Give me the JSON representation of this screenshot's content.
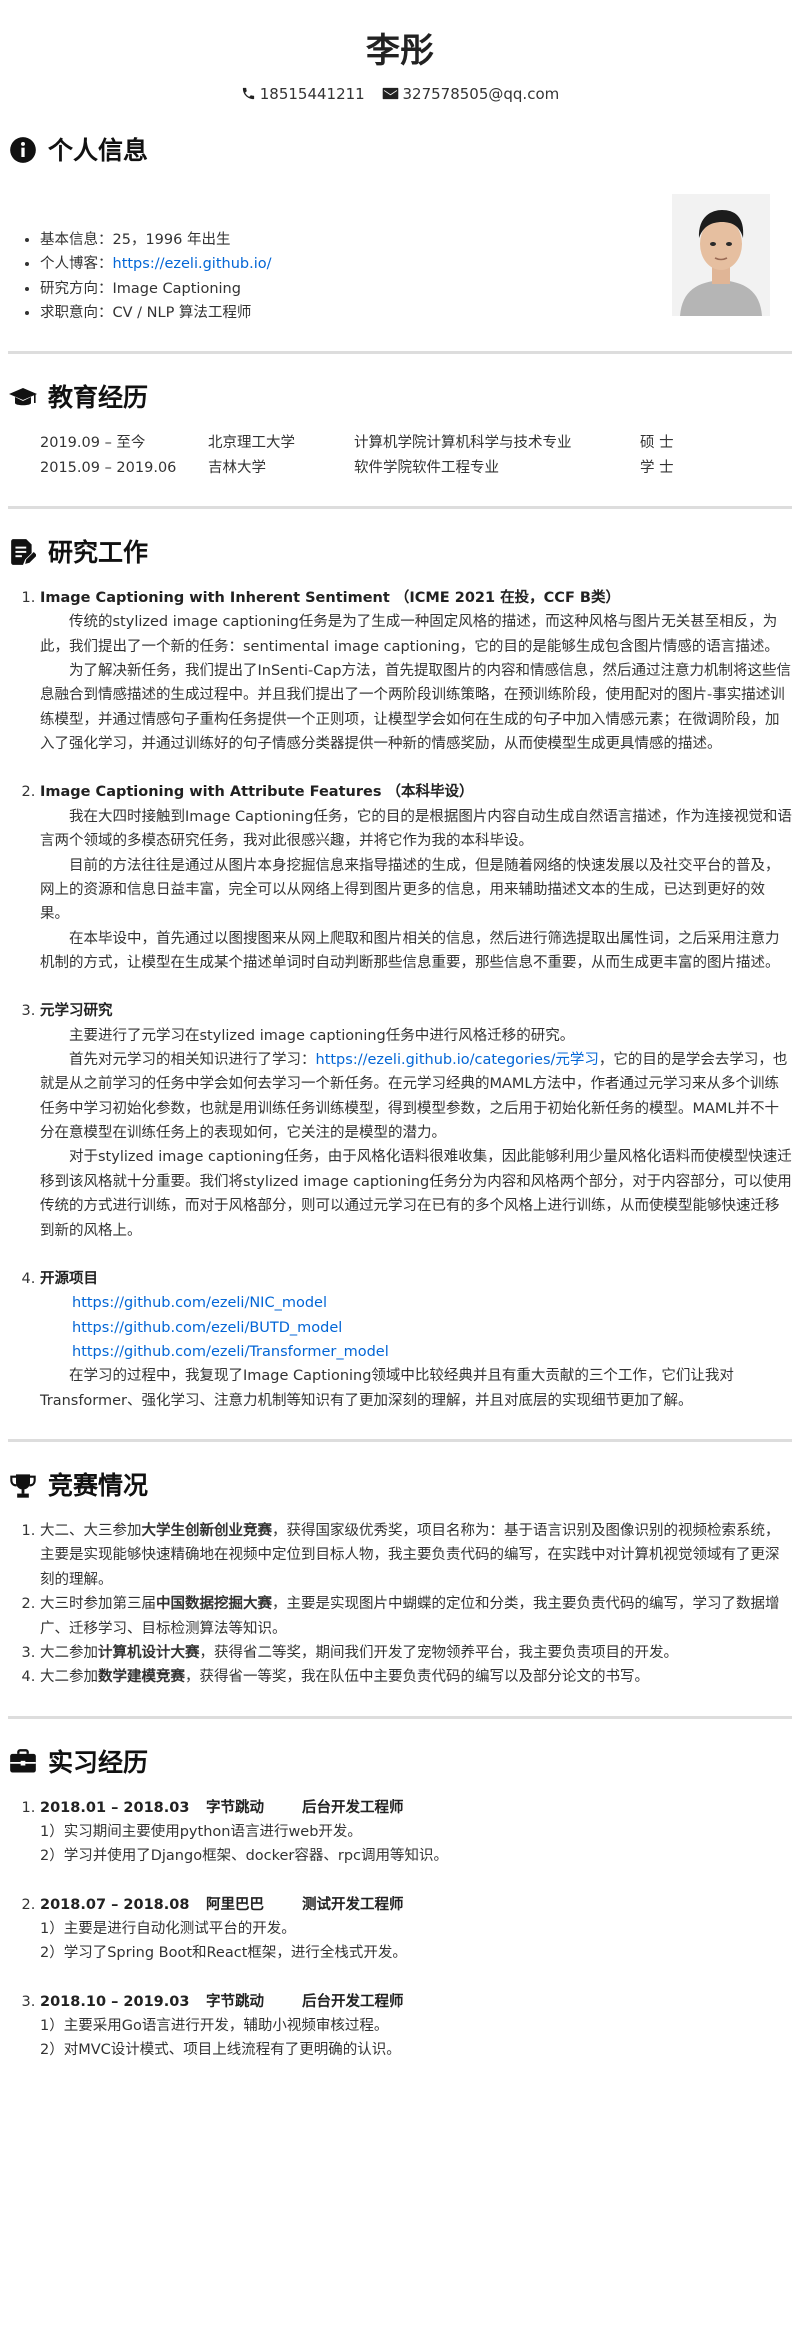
{
  "header": {
    "name": "李彤",
    "phone": "18515441211",
    "email": "327578505@qq.com"
  },
  "sections": {
    "personal": "个人信息",
    "education": "教育经历",
    "research": "研究工作",
    "competition": "竞赛情况",
    "internship": "实习经历"
  },
  "personal": {
    "items": [
      {
        "label": "基本信息：",
        "value": "25，1996 年出生"
      },
      {
        "label": "个人博客：",
        "link": "https://ezeli.github.io/"
      },
      {
        "label": "研究方向：",
        "value": "Image Captioning"
      },
      {
        "label": "求职意向：",
        "value": "CV / NLP 算法工程师"
      }
    ]
  },
  "education": [
    {
      "period": "2019.09 – 至今",
      "school": "北京理工大学",
      "major": "计算机学院计算机科学与技术专业",
      "degree": "硕 士"
    },
    {
      "period": "2015.09 – 2019.06",
      "school": "吉林大学",
      "major": "软件学院软件工程专业",
      "degree": "学 士"
    }
  ],
  "research": {
    "r1": {
      "title": "Image Captioning with Inherent Sentiment （ICME 2021 在投，CCF B类）",
      "p1": "传统的stylized image captioning任务是为了生成一种固定风格的描述，而这种风格与图片无关甚至相反，为此，我们提出了一个新的任务：sentimental image captioning，它的目的是能够生成包含图片情感的语言描述。",
      "p2": "为了解决新任务，我们提出了InSenti-Cap方法，首先提取图片的内容和情感信息，然后通过注意力机制将这些信息融合到情感描述的生成过程中。并且我们提出了一个两阶段训练策略，在预训练阶段，使用配对的图片-事实描述训练模型，并通过情感句子重构任务提供一个正则项，让模型学会如何在生成的句子中加入情感元素；在微调阶段，加入了强化学习，并通过训练好的句子情感分类器提供一种新的情感奖励，从而使模型生成更具情感的描述。"
    },
    "r2": {
      "title": "Image Captioning with Attribute Features （本科毕设）",
      "p1": "我在大四时接触到Image Captioning任务，它的目的是根据图片内容自动生成自然语言描述，作为连接视觉和语言两个领域的多模态研究任务，我对此很感兴趣，并将它作为我的本科毕设。",
      "p2": "目前的方法往往是通过从图片本身挖掘信息来指导描述的生成，但是随着网络的快速发展以及社交平台的普及，网上的资源和信息日益丰富，完全可以从网络上得到图片更多的信息，用来辅助描述文本的生成，已达到更好的效果。",
      "p3": "在本毕设中，首先通过以图搜图来从网上爬取和图片相关的信息，然后进行筛选提取出属性词，之后采用注意力机制的方式，让模型在生成某个描述单词时自动判断那些信息重要，那些信息不重要，从而生成更丰富的图片描述。"
    },
    "r3": {
      "title": "元学习研究",
      "p0": "主要进行了元学习在stylized image captioning任务中进行风格迁移的研究。",
      "p1_pre": "首先对元学习的相关知识进行了学习：",
      "p1_link": "https://ezeli.github.io/categories/元学习",
      "p1_post": "，它的目的是学会去学习，也就是从之前学习的任务中学会如何去学习一个新任务。在元学习经典的MAML方法中，作者通过元学习来从多个训练任务中学习初始化参数，也就是用训练任务训练模型，得到模型参数，之后用于初始化新任务的模型。MAML并不十分在意模型在训练任务上的表现如何，它关注的是模型的潜力。",
      "p2": "对于stylized image captioning任务，由于风格化语料很难收集，因此能够利用少量风格化语料而使模型快速迁移到该风格就十分重要。我们将stylized image captioning任务分为内容和风格两个部分，对于内容部分，可以使用传统的方式进行训练，而对于风格部分，则可以通过元学习在已有的多个风格上进行训练，从而使模型能够快速迁移到新的风格上。"
    },
    "r4": {
      "title": "开源项目",
      "links": [
        "https://github.com/ezeli/NIC_model",
        "https://github.com/ezeli/BUTD_model",
        "https://github.com/ezeli/Transformer_model"
      ],
      "p1": "在学习的过程中，我复现了Image Captioning领域中比较经典并且有重大贡献的三个工作，它们让我对Transformer、强化学习、注意力机制等知识有了更加深刻的理解，并且对底层的实现细节更加了解。"
    }
  },
  "competition": [
    {
      "pre": "大二、大三参加",
      "bold": "大学生创新创业竞赛",
      "post": "，获得国家级优秀奖，项目名称为：基于语言识别及图像识别的视频检索系统，主要是实现能够快速精确地在视频中定位到目标人物，我主要负责代码的编写，在实践中对计算机视觉领域有了更深刻的理解。"
    },
    {
      "pre": "大三时参加第三届",
      "bold": "中国数据挖掘大赛",
      "post": "，主要是实现图片中蝴蝶的定位和分类，我主要负责代码的编写，学习了数据增广、迁移学习、目标检测算法等知识。"
    },
    {
      "pre": "大二参加",
      "bold": "计算机设计大赛",
      "post": "，获得省二等奖，期间我们开发了宠物领养平台，我主要负责项目的开发。"
    },
    {
      "pre": "大二参加",
      "bold": "数学建模竞赛",
      "post": "，获得省一等奖，我在队伍中主要负责代码的编写以及部分论文的书写。"
    }
  ],
  "internship": [
    {
      "period": "2018.01 – 2018.03",
      "company": "字节跳动",
      "role": "后台开发工程师",
      "lines": [
        "1）实习期间主要使用python语言进行web开发。",
        "2）学习并使用了Django框架、docker容器、rpc调用等知识。"
      ]
    },
    {
      "period": "2018.07 – 2018.08",
      "company": "阿里巴巴",
      "role": "测试开发工程师",
      "lines": [
        "1）主要是进行自动化测试平台的开发。",
        "2）学习了Spring Boot和React框架，进行全栈式开发。"
      ]
    },
    {
      "period": "2018.10 – 2019.03",
      "company": "字节跳动",
      "role": "后台开发工程师",
      "lines": [
        "1）主要采用Go语言进行开发，辅助小视频审核过程。",
        "2）对MVC设计模式、项目上线流程有了更明确的认识。"
      ]
    }
  ]
}
